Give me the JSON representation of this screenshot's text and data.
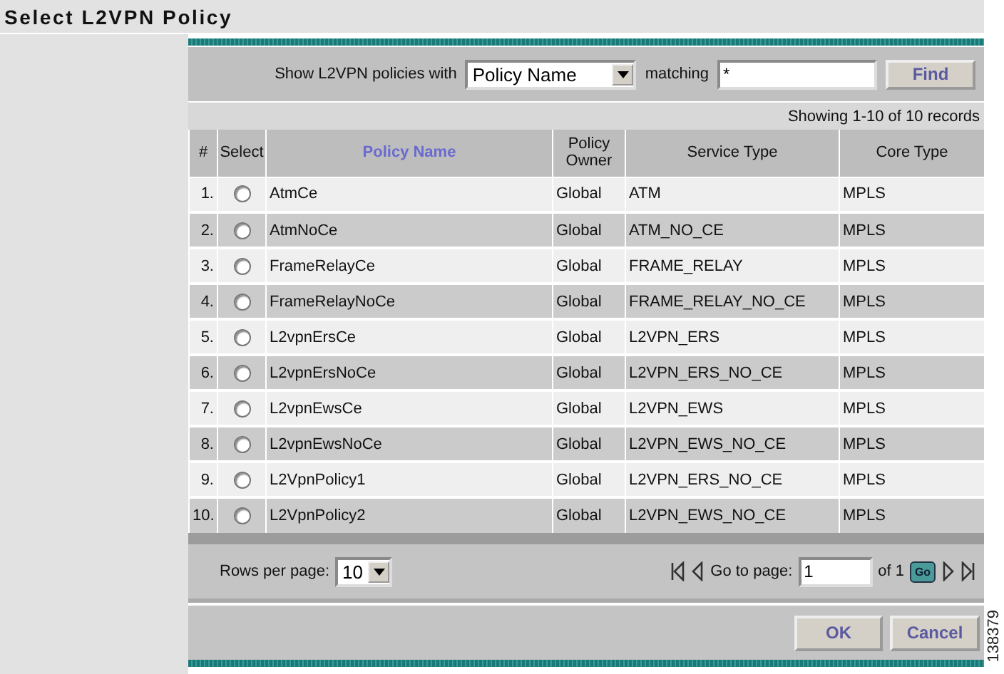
{
  "title": "Select L2VPN Policy",
  "filter": {
    "label": "Show L2VPN policies with",
    "field": "Policy Name",
    "matching_label": "matching",
    "value": "*",
    "button": "Find"
  },
  "record_count": "Showing 1-10 of 10 records",
  "table": {
    "columns": [
      "#",
      "Select",
      "Policy Name",
      "Policy Owner",
      "Service Type",
      "Core Type"
    ],
    "rows": [
      {
        "index": "1.",
        "selected": false,
        "name": "AtmCe",
        "owner": "Global",
        "service": "ATM",
        "core": "MPLS"
      },
      {
        "index": "2.",
        "selected": false,
        "name": "AtmNoCe",
        "owner": "Global",
        "service": "ATM_NO_CE",
        "core": "MPLS"
      },
      {
        "index": "3.",
        "selected": false,
        "name": "FrameRelayCe",
        "owner": "Global",
        "service": "FRAME_RELAY",
        "core": "MPLS"
      },
      {
        "index": "4.",
        "selected": false,
        "name": "FrameRelayNoCe",
        "owner": "Global",
        "service": "FRAME_RELAY_NO_CE",
        "core": "MPLS"
      },
      {
        "index": "5.",
        "selected": false,
        "name": "L2vpnErsCe",
        "owner": "Global",
        "service": "L2VPN_ERS",
        "core": "MPLS"
      },
      {
        "index": "6.",
        "selected": false,
        "name": "L2vpnErsNoCe",
        "owner": "Global",
        "service": "L2VPN_ERS_NO_CE",
        "core": "MPLS"
      },
      {
        "index": "7.",
        "selected": false,
        "name": "L2vpnEwsCe",
        "owner": "Global",
        "service": "L2VPN_EWS",
        "core": "MPLS"
      },
      {
        "index": "8.",
        "selected": false,
        "name": "L2vpnEwsNoCe",
        "owner": "Global",
        "service": "L2VPN_EWS_NO_CE",
        "core": "MPLS"
      },
      {
        "index": "9.",
        "selected": false,
        "name": "L2VpnPolicy1",
        "owner": "Global",
        "service": "L2VPN_ERS_NO_CE",
        "core": "MPLS"
      },
      {
        "index": "10.",
        "selected": false,
        "name": "L2VpnPolicy2",
        "owner": "Global",
        "service": "L2VPN_EWS_NO_CE",
        "core": "MPLS"
      }
    ]
  },
  "pager": {
    "rows_label": "Rows per page:",
    "rows_value": "10",
    "goto_label": "Go to page:",
    "page": "1",
    "of": "of 1",
    "go": "Go"
  },
  "buttons": [
    "OK",
    "Cancel"
  ],
  "figure_number": "138379"
}
